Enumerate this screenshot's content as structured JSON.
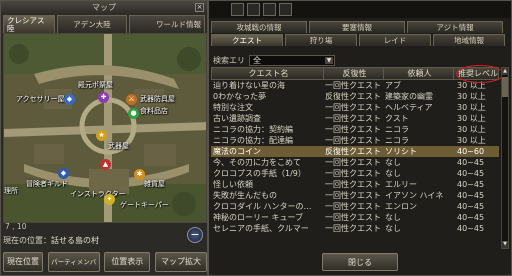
{
  "map": {
    "title": "マップ",
    "close": "×",
    "tabs": [
      {
        "label": "クレシアス 陸"
      },
      {
        "label": "アデン大陸"
      },
      {
        "label": "ワールド情報"
      }
    ],
    "labels": {
      "accessory": "アクセサリー屋",
      "temple": "殿元ポ祭屋",
      "weapon": "武器防具屋",
      "supply": "食料品店",
      "guild": "冒険者ギルド",
      "supplies": "雑貨屋",
      "instructor": "インストラクター",
      "gatekeeper": "ゲートキーパー",
      "armory": "武器屋",
      "shop_left": "理所"
    },
    "coords": "7 , 10",
    "location_prefix": "現在の位置：",
    "location_name": "話せる島の村",
    "zoom": "−",
    "buttons": {
      "current": "現在位置",
      "other": "パーティメンバ",
      "display": "位置表示",
      "expand": "マップ拡大"
    }
  },
  "quest": {
    "tabs_row1": [
      {
        "label": "攻城戦の情報"
      },
      {
        "label": "要塞情報"
      },
      {
        "label": "アジト情報"
      }
    ],
    "tabs_row2": [
      {
        "label": "クエスト"
      },
      {
        "label": "狩り場"
      },
      {
        "label": "レイド"
      },
      {
        "label": "地域情報"
      }
    ],
    "filter_label": "検索エリ",
    "filter_value": "全",
    "headers": {
      "name": "クエスト名",
      "repeat": "反復性",
      "client": "依頼人",
      "level": "推奨レベル"
    },
    "rows": [
      {
        "name": "辿り着けない星の海",
        "repeat": "一回性クエスト",
        "client": "アブ",
        "level": "30 以上"
      },
      {
        "name": "0わかなった夢",
        "repeat": "反復性クエスト",
        "client": "建築家の幽霊",
        "level": "30 以上"
      },
      {
        "name": "特別な注文",
        "repeat": "一回性クエスト",
        "client": "ヘルベティア",
        "level": "30 以上"
      },
      {
        "name": "古い遺跡調査",
        "repeat": "一回性クエスト",
        "client": "クスト",
        "level": "30 以上"
      },
      {
        "name": "ニコラの協力：契約編",
        "repeat": "一回性クエスト",
        "client": "ニコラ",
        "level": "30 以上"
      },
      {
        "name": "ニコラの協力：配達編",
        "repeat": "一回性クエスト",
        "client": "ニコラ",
        "level": "30 以上"
      },
      {
        "name": "魔法のコイン",
        "repeat": "反復性クエスト",
        "client": "ソリシト",
        "level": "40~60"
      },
      {
        "name": "今、その刃に力をこめて",
        "repeat": "一回性クエスト",
        "client": "なし",
        "level": "40~45"
      },
      {
        "name": "クロコプスの手紙（1/9）",
        "repeat": "一回性クエスト",
        "client": "なし",
        "level": "40~45"
      },
      {
        "name": "怪しい依頼",
        "repeat": "一回性クエスト",
        "client": "エルリー",
        "level": "40~45"
      },
      {
        "name": "失敗が生んだもの",
        "repeat": "一回性クエスト",
        "client": "イアソン ハイネ",
        "level": "40~45"
      },
      {
        "name": "クロコダイル ハンターの…",
        "repeat": "一回性クエスト",
        "client": "エンロン",
        "level": "40~45"
      },
      {
        "name": "神秘のローリー キューブ",
        "repeat": "一回性クエスト",
        "client": "なし",
        "level": "40~45"
      },
      {
        "name": "セレニアの手紙、クルマー",
        "repeat": "一回性クエスト",
        "client": "なし",
        "level": "40~45"
      }
    ],
    "close_label": "閉じる",
    "scroll_up": "▲",
    "scroll_down": "▼",
    "dropdown_arrow": "▼"
  },
  "colors": {
    "selected_row": "#6e5d34",
    "highlight_circle": "#d42020"
  }
}
